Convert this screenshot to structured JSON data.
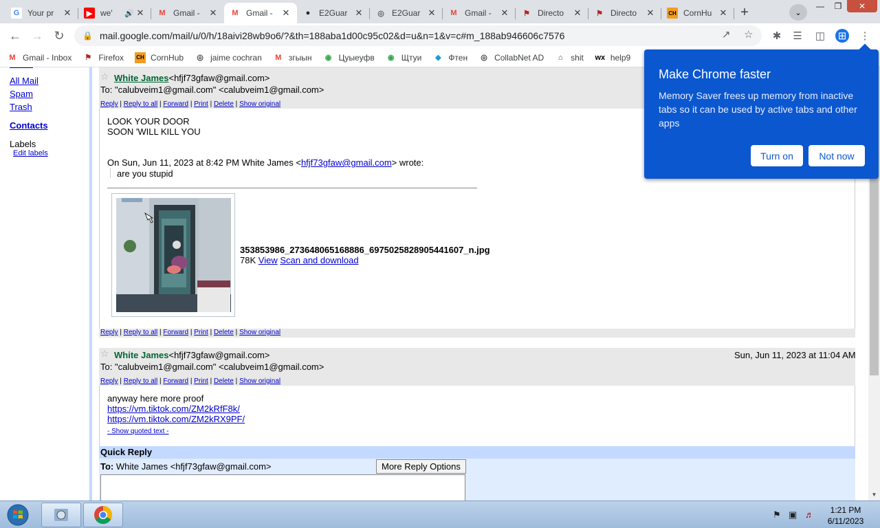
{
  "browser": {
    "tabs": [
      {
        "title": "Your pr",
        "icon": "google-icon"
      },
      {
        "title": "we'",
        "icon": "youtube-icon",
        "audio": true
      },
      {
        "title": "Gmail -",
        "icon": "gmail-icon"
      },
      {
        "title": "Gmail -",
        "icon": "gmail-icon",
        "active": true
      },
      {
        "title": "E2Guar",
        "icon": "github-icon"
      },
      {
        "title": "E2Guar",
        "icon": "globe-icon"
      },
      {
        "title": "Gmail -",
        "icon": "gmail-icon"
      },
      {
        "title": "Directo",
        "icon": "directory-icon"
      },
      {
        "title": "Directo",
        "icon": "directory-icon"
      },
      {
        "title": "CornHu",
        "icon": "cornhub-icon"
      }
    ],
    "url": "mail.google.com/mail/u/0/h/18aivi28wb9o6/?&th=188aba1d00c95c02&d=u&n=1&v=c#m_188ab946606c7576",
    "bookmarks": [
      {
        "label": "Gmail - Inbox",
        "icon": "gmail-icon"
      },
      {
        "label": "Firefox",
        "icon": "firefox-icon"
      },
      {
        "label": "CornHub",
        "icon": "cornhub-icon"
      },
      {
        "label": "jaime cochran",
        "icon": "globe-icon"
      },
      {
        "label": "згыын",
        "icon": "gmail-icon"
      },
      {
        "label": "Цуыеуфв",
        "icon": "maps-icon"
      },
      {
        "label": "Щтуи",
        "icon": "maps-icon"
      },
      {
        "label": "Фтен",
        "icon": "diamond-icon"
      },
      {
        "label": "CollabNet AD",
        "icon": "globe-icon"
      },
      {
        "label": "shit",
        "icon": "hfs-icon"
      },
      {
        "label": "help9",
        "icon": "wix-icon"
      }
    ],
    "popup": {
      "title": "Make Chrome faster",
      "body": "Memory Saver frees up memory from inactive tabs so it can be used by active tabs and other apps",
      "turn_on": "Turn on",
      "not_now": "Not now"
    }
  },
  "nav": {
    "all_mail": "All Mail",
    "spam": "Spam",
    "trash": "Trash",
    "contacts": "Contacts",
    "labels": "Labels",
    "edit_labels": "Edit labels"
  },
  "actions": {
    "reply": "Reply",
    "reply_all": "Reply to all",
    "forward": "Forward",
    "print": "Print",
    "delete": "Delete",
    "show_original": "Show original",
    "sep": "|"
  },
  "message1": {
    "sender": "White James",
    "sender_email": "<hfjf73gfaw@gmail.com>",
    "to": "To: \"calubveim1@gmail.com\" <calubveim1@gmail.com>",
    "body_line1": "LOOK YOUR DOOR",
    "body_line2": "SOON 'WILL KILL YOU",
    "quote_header_prefix": "On Sun, Jun 11, 2023 at 8:42 PM White James <",
    "quote_header_email": "hfjf73gfaw@gmail.com",
    "quote_header_suffix": "> wrote:",
    "quoted": "are you stupid",
    "attachment_name": "353853986_273648065168886_6975025828905441607_n.jpg",
    "attachment_size": "78K",
    "view": "View",
    "scan": "Scan and download"
  },
  "message2": {
    "sender": "White James",
    "sender_email": "<hfjf73gfaw@gmail.com>",
    "to": "To: \"calubveim1@gmail.com\" <calubveim1@gmail.com>",
    "date": "Sun, Jun 11, 2023 at 11:04 AM",
    "body": "anyway here more proof",
    "link1": "https://vm.tiktok.com/ZM2kRfF8k/",
    "link2": "https://vm.tiktok.com/ZM2kRX9PF/",
    "show_quoted": "- Show quoted text -"
  },
  "quick_reply": {
    "title": "Quick Reply",
    "to_label": "To:",
    "to_value": "White James <hfjf73gfaw@gmail.com>",
    "more_options": "More Reply Options"
  },
  "taskbar": {
    "time": "1:21 PM",
    "date": "6/11/2023"
  }
}
